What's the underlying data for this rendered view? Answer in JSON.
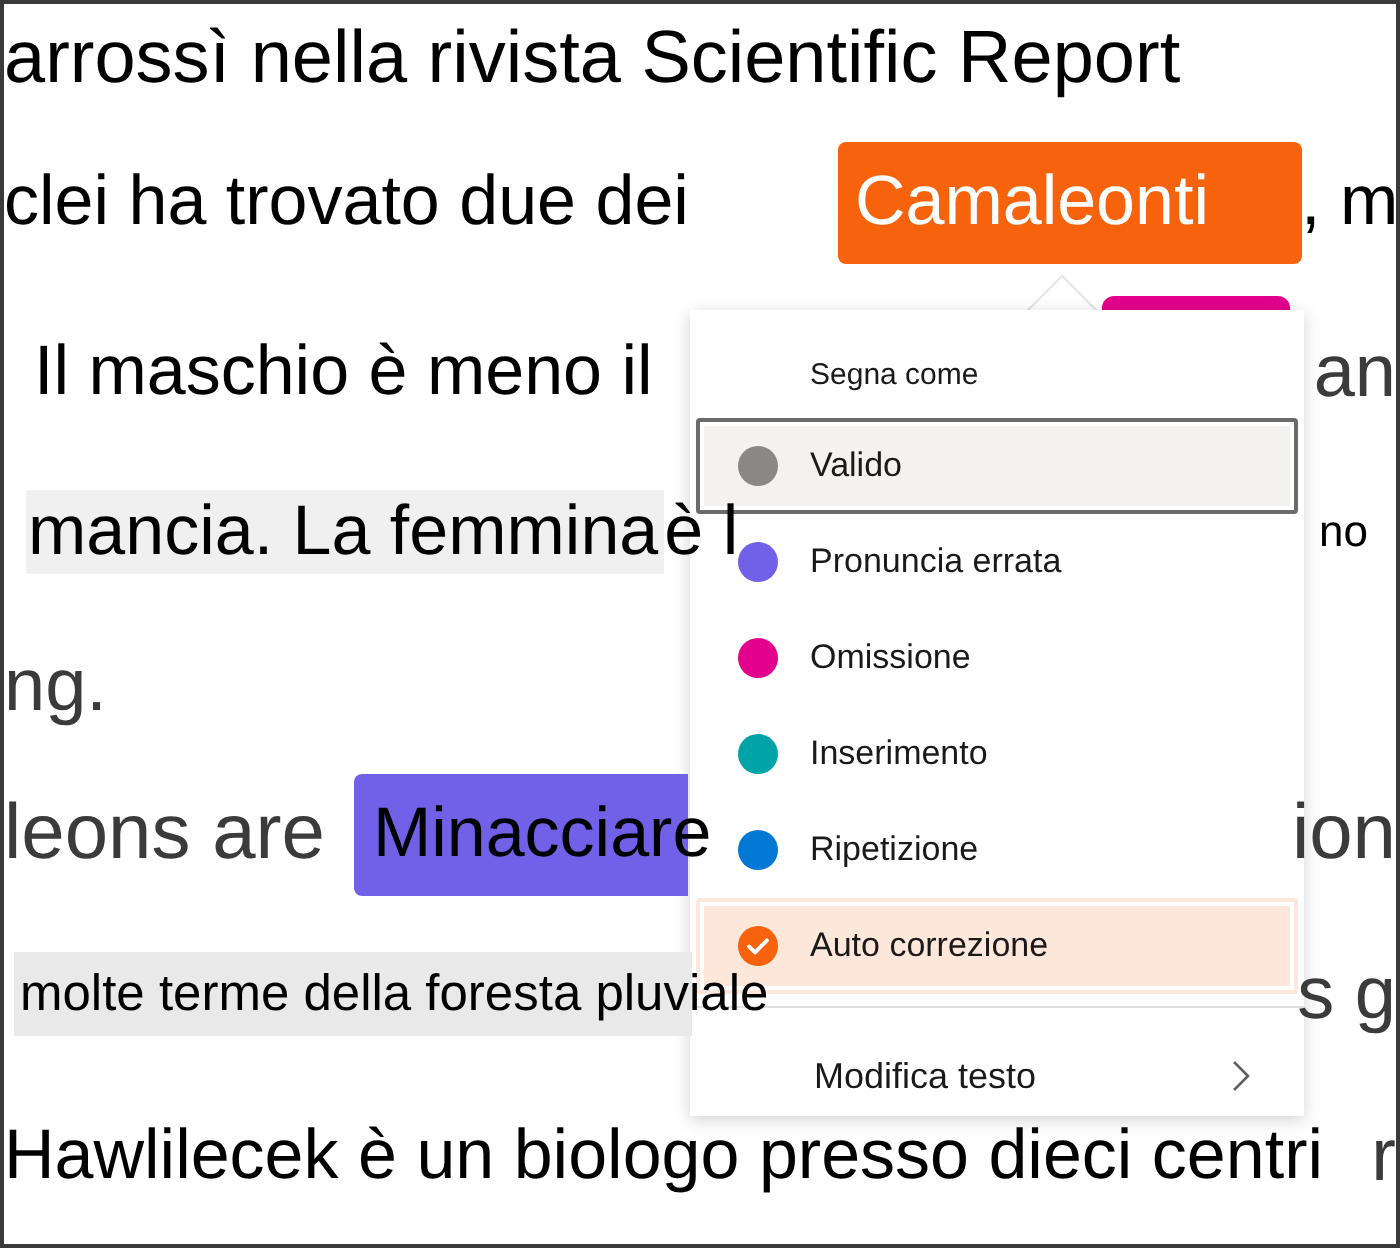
{
  "rows": [
    {
      "start": [
        {
          "kind": "plain",
          "text": "arrossì nella rivista Scientific Report"
        }
      ]
    },
    {
      "start": [
        {
          "kind": "plain",
          "text": "clei ha trovato due dei"
        },
        {
          "kind": "badge",
          "text": "Camaleonti",
          "color": "#f7630c"
        }
      ],
      "end": [
        {
          "kind": "plain",
          "text": ", m"
        }
      ]
    },
    {
      "start": [
        {
          "kind": "plain",
          "text": "Il maschio è meno il"
        }
      ],
      "end": [
        {
          "kind": "muted",
          "text": "an"
        }
      ]
    },
    {
      "start": [
        {
          "kind": "highlight",
          "text": "mancia. La femmina"
        },
        {
          "kind": "plain",
          "text": "è l"
        }
      ],
      "end": [
        {
          "kind": "small",
          "text": "no"
        }
      ]
    },
    {
      "start": [
        {
          "kind": "muted",
          "text": "ng."
        }
      ]
    },
    {
      "start": [
        {
          "kind": "muted",
          "text": "leons are"
        },
        {
          "kind": "marker",
          "text": "Minacciare",
          "color": "#7160e8"
        }
      ],
      "end": [
        {
          "kind": "muted",
          "text": "ion"
        }
      ]
    },
    {
      "start": [
        {
          "kind": "highlight",
          "text": "molte terme della foresta pluviale"
        }
      ],
      "end": [
        {
          "kind": "muted",
          "text": "s g"
        }
      ]
    },
    {
      "start": [
        {
          "kind": "plain",
          "text": "Hawlilecek è un biologo presso dieci centri"
        }
      ],
      "end": [
        {
          "kind": "muted",
          "text": "r"
        }
      ]
    }
  ],
  "covered_highlight": {
    "color": "#e3008c"
  },
  "menu": {
    "title": "Segna come",
    "items": [
      {
        "label": "Valido",
        "color": "#8a8886",
        "focused": true,
        "selected": false
      },
      {
        "label": "Pronuncia errata",
        "color": "#7160e8",
        "focused": false,
        "selected": false
      },
      {
        "label": "Omissione",
        "color": "#e3008c",
        "focused": false,
        "selected": false
      },
      {
        "label": "Inserimento",
        "color": "#00a3a8",
        "focused": false,
        "selected": false
      },
      {
        "label": "Ripetizione",
        "color": "#0078d4",
        "focused": false,
        "selected": false
      },
      {
        "label": "Auto correzione",
        "color": "#f7630c",
        "focused": false,
        "selected": true
      }
    ],
    "footer_item": {
      "label": "Modifica testo"
    }
  }
}
